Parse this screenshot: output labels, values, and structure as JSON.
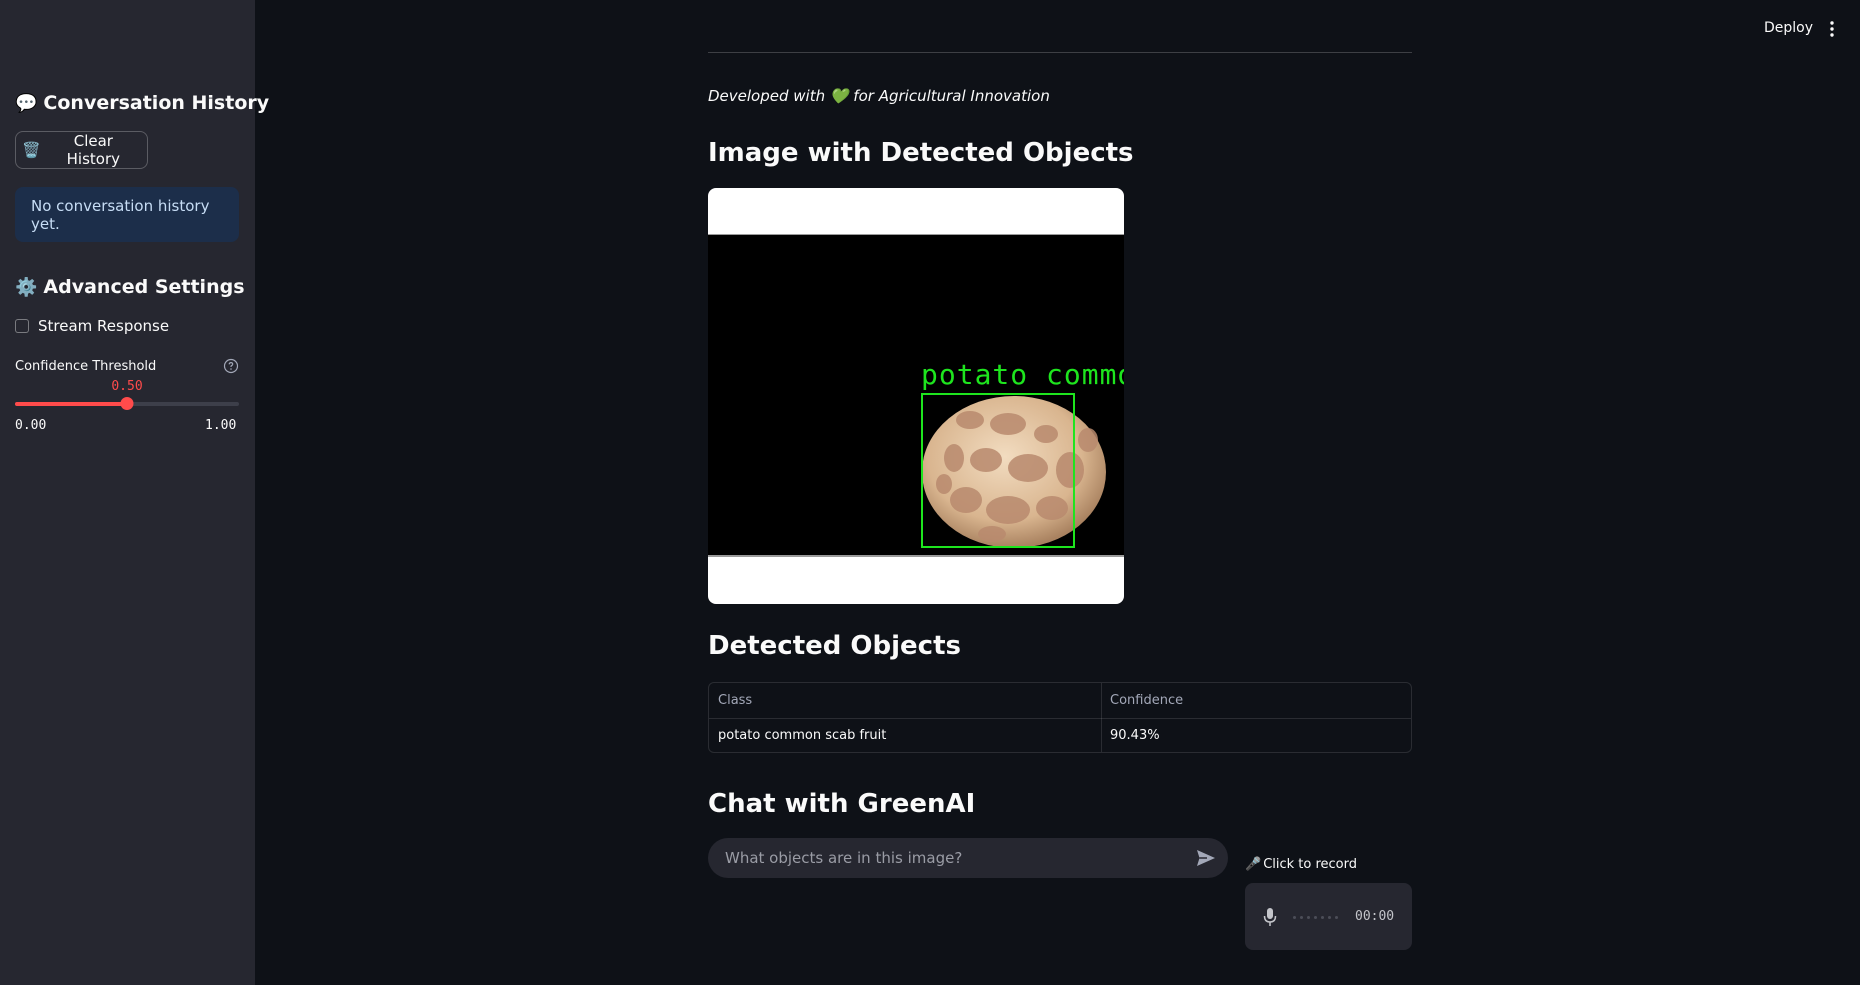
{
  "sidebar": {
    "history_heading": "Conversation History",
    "history_heading_emoji": "💬",
    "clear_button_emoji": "🗑️",
    "clear_button_label": "Clear History",
    "info_message": "No conversation history yet.",
    "settings_heading": "Advanced Settings",
    "settings_heading_emoji": "⚙️",
    "stream_checkbox_label": "Stream Response",
    "stream_checked": false,
    "slider": {
      "label": "Confidence Threshold",
      "value": "0.50",
      "value_num": 0.5,
      "min": "0.00",
      "max": "1.00",
      "accent_color": "#ff4b4b"
    }
  },
  "header": {
    "deploy_label": "Deploy"
  },
  "main": {
    "dev_note": "Developed with 💚 for Agricultural Innovation",
    "image_heading": "Image with Detected Objects",
    "image_label": "potato commo",
    "objects_heading": "Detected Objects",
    "table": {
      "headers": [
        "Class",
        "Confidence"
      ],
      "rows": [
        [
          "potato common scab fruit",
          "90.43%"
        ]
      ]
    },
    "chat_heading": "Chat with GreenAI",
    "chat_placeholder": "What objects are in this image?",
    "record_emoji": "🎤",
    "record_label": "Click to record",
    "timer": "00:00"
  },
  "colors": {
    "background": "#0e1117",
    "sidebar": "#262730",
    "accent": "#ff4b4b",
    "bbox": "#1ee51e",
    "info_bg": "#1c2e4a"
  }
}
